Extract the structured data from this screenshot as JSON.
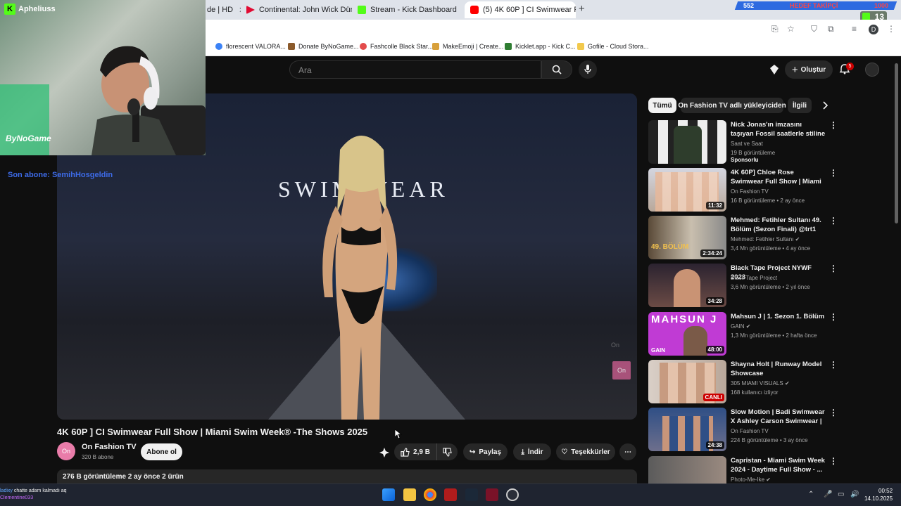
{
  "browser": {
    "tabs": [
      {
        "title": "de | HD",
        "active": false
      },
      {
        "title": "Continental: John Wick Dünyas",
        "active": false
      },
      {
        "title": "Stream - Kick Dashboard",
        "active": false
      },
      {
        "title": "(5) 4K 60P ] CI Swimwear F",
        "active": true
      }
    ],
    "new_tab": "+",
    "bookmarks": [
      {
        "label": "florescent VALORA..."
      },
      {
        "label": "Donate ByNoGame..."
      },
      {
        "label": "Fashcolle Black Star..."
      },
      {
        "label": "MakeEmoji | Create..."
      },
      {
        "label": "Kicklet.app - Kick C..."
      },
      {
        "label": "Gofile - Cloud Stora..."
      }
    ],
    "profile_initial": "D"
  },
  "stream_overlay": {
    "channel_name": "Apheliuss",
    "banner_left": "552",
    "banner_center": "HEDEF TAKİPÇİ",
    "banner_right": "1000",
    "viewer_count": "13",
    "sponsor_logo": "ByNoGame",
    "sub_alert": "Son abone: SemihHosgeldin"
  },
  "youtube": {
    "search_placeholder": "Ara",
    "create_label": "Oluştur",
    "notification_count": "5",
    "video": {
      "brand_text": "SWIM WEAR",
      "watermark": "On",
      "title": "4K 60P ] CI Swimwear Full Show | Miami Swim Week® -The Shows 2025",
      "channel": "On Fashion TV",
      "subscribers": "320 B abone",
      "subscribe_label": "Abone ol",
      "likes": "2,9 B",
      "share_label": "Paylaş",
      "download_label": "İndir",
      "thanks_label": "Teşekkürler",
      "description_meta": "276 B görüntüleme  2 ay önce  2 ürün",
      "channel_avatar_text": "On"
    },
    "chips": [
      "Tümü",
      "On Fashion TV adlı yükleyiciden",
      "İlgili"
    ],
    "recommendations": [
      {
        "title": "Nick Jonas'ın imzasını taşıyan Fossil saatlerle stiline özgün b...",
        "channel": "Saat ve Saat",
        "meta": "19 B görüntüleme",
        "extra": "Sponsorlu",
        "duration": "",
        "verified": false
      },
      {
        "title": "4K 60P] Chloe Rose Swimwear Full Show | Miami swim week ...",
        "channel": "On Fashion TV",
        "meta": "16 B görüntüleme • 2 ay önce",
        "extra": "",
        "duration": "11:32",
        "verified": false
      },
      {
        "title": "Mehmed: Fetihler Sultanı 49. Bölüm (Sezon Finali) @trt1",
        "channel": "Mehmed: Fetihler Sultanı",
        "meta": "3,4 Mn görüntüleme • 4 ay önce",
        "extra": "",
        "duration": "2:34:24",
        "verified": true
      },
      {
        "title": "Black Tape Project NYWF 2023",
        "channel": "Black Tape Project",
        "meta": "3,6 Mn görüntüleme • 2 yıl önce",
        "extra": "",
        "duration": "34:28",
        "verified": false
      },
      {
        "title": "Mahsun J | 1. Sezon 1. Bölüm",
        "channel": "GAIN",
        "meta": "1,3 Mn görüntüleme • 2 hafta önce",
        "extra": "",
        "duration": "48:00",
        "verified": true
      },
      {
        "title": "Shayna Holt | Runway Model Showcase",
        "channel": "305 MIAMI VISUALS",
        "meta": "168 kullanıcı izliyor",
        "extra": "",
        "duration": "CANLI",
        "verified": true
      },
      {
        "title": "Slow Motion | Badi Swimwear X Ashley Carson Swimwear | 20...",
        "channel": "On Fashion TV",
        "meta": "224 B görüntüleme • 3 ay önce",
        "extra": "",
        "duration": "24:38",
        "verified": false
      },
      {
        "title": "Capristan - Miami Swim Week 2024 - Daytime Full Show - ...",
        "channel": "Photo-Me-Ike",
        "meta": "",
        "extra": "",
        "duration": "",
        "verified": true
      }
    ],
    "thumb_texts": [
      "49. BÖLÜM",
      "MAHSUN J",
      "GAIN"
    ]
  },
  "taskbar": {
    "time": "00:52",
    "date": "14.10.2025",
    "chat": [
      {
        "user": "ladixy",
        "message": "chatte adam kalmadı aq"
      },
      {
        "user": "Clementine033",
        "message": ""
      }
    ]
  },
  "colors": {
    "kick_green": "#53fc18",
    "yt_red": "#cc0000",
    "bg": "#0f0f0f"
  }
}
